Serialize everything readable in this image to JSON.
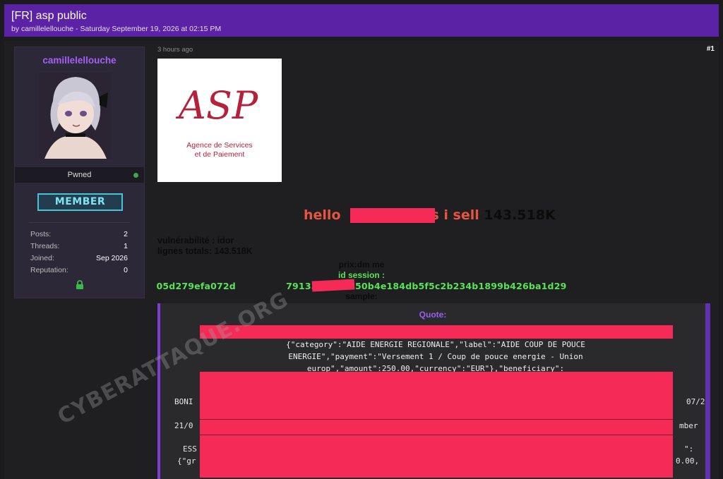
{
  "thread": {
    "title": "[FR] asp public",
    "subtitle": "by camillelellouche - Saturday September 19, 2026 at 02:15 PM"
  },
  "user": {
    "username": "camillelellouche",
    "status": "Pwned",
    "rank_badge": "MEMBER",
    "stats": [
      {
        "label": "Posts:",
        "value": "2"
      },
      {
        "label": "Threads:",
        "value": "1"
      },
      {
        "label": "Joined:",
        "value": "Sep 2026"
      },
      {
        "label": "Reputation:",
        "value": "0"
      }
    ]
  },
  "post": {
    "time_ago": "3 hours ago",
    "number": "#1",
    "logo_text": {
      "big": "ASP",
      "line1": "Agence de Services",
      "line2": "et de Paiement"
    },
    "hello_prefix": "hello",
    "hello_mid": "s i sell",
    "hello_count": "143.518K",
    "vuln_line": "vulnérabilité : idor",
    "lines_line": "lignes totals: 143.518K",
    "prix": "prix:dm me",
    "id_session_label": "id session :",
    "hash": "05d279efa072d        7913564892750b4e184db5f5c2b234b1899b426ba1d29",
    "sample": "sample:",
    "quote_label": "Quote:",
    "quote_lines": [
      "{\"category\":\"AIDE ENERGIE REGIONALE\",\"label\":\"AIDE COUP DE POUCE",
      "ENERGIE\",\"payment\":\"Versement 1 / Coup de pouce energie - Union",
      "europ\",\"amount\":250.00,\"currency\":\"EUR\"},\"beneficiary\":"
    ],
    "quote_fragments": {
      "bon": "BONI",
      "date_right": "07/2",
      "d21": "21/0",
      "mber": "mber",
      "ess": "ESS",
      "colon": "\":",
      "gr": "{\"gr",
      "amt": "0.00,"
    }
  },
  "watermark": "CYBERATTAQUE.ORG",
  "colors": {
    "header": "#5b22a6",
    "username": "#a261f5",
    "id_session": "#56e454",
    "redaction": "#f52a57"
  }
}
